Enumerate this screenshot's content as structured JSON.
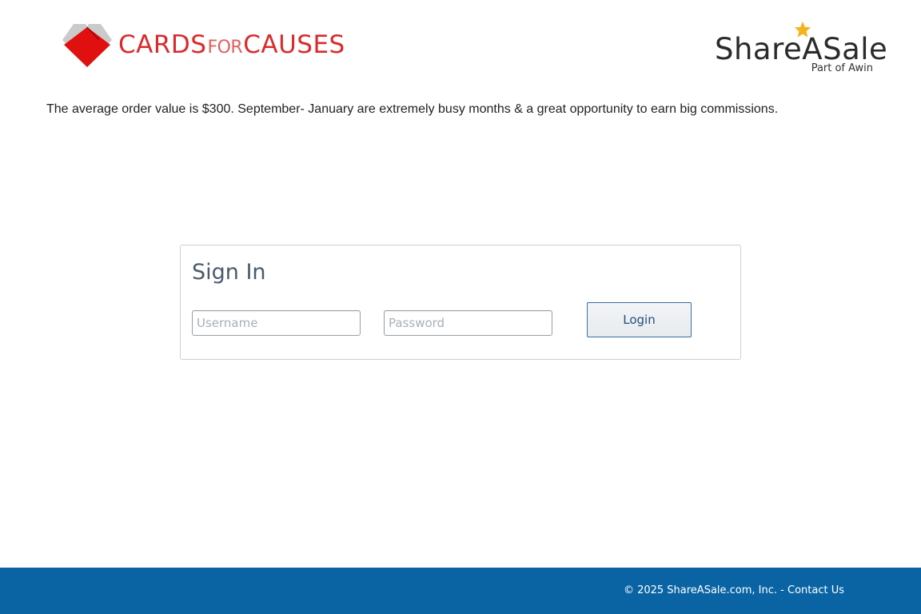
{
  "merchant": {
    "name_part1": "CARDS",
    "name_part2": "FOR",
    "name_part3": "CAUSES",
    "brand_color": "#d92b2b"
  },
  "network": {
    "name": "ShareASale",
    "tagline": "Part of Awin",
    "star_color": "#f5b21a"
  },
  "promo": {
    "text": "The average order value is $300. September- January are extremely busy months & a great opportunity to earn big commissions."
  },
  "signin": {
    "title": "Sign In",
    "username_placeholder": "Username",
    "password_placeholder": "Password",
    "login_label": "Login"
  },
  "footer": {
    "copyright": "© 2025 ShareASale.com, Inc. - ",
    "contact_label": "Contact Us",
    "background_color": "#0a64a4"
  }
}
